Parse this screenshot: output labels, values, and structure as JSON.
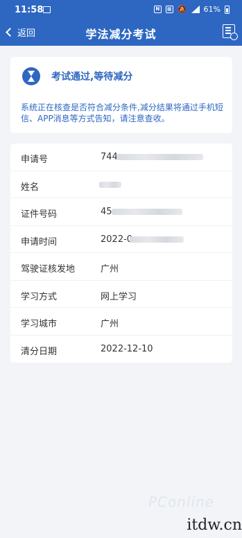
{
  "status_bar": {
    "time": "11:58",
    "battery": "61%"
  },
  "nav": {
    "back_label": "返回",
    "title": "学法减分考试"
  },
  "status_card": {
    "title": "考试通过,等待减分",
    "description": "系统正在核查是否符合减分条件,减分结果将通过手机短信、APP消息等方式告知，请注意查收。"
  },
  "info": {
    "rows": [
      {
        "label": "申请号",
        "value": "744"
      },
      {
        "label": "姓名",
        "value": ""
      },
      {
        "label": "证件号码",
        "value": "45"
      },
      {
        "label": "申请时间",
        "value": "2022-0"
      },
      {
        "label": "驾驶证核发地",
        "value": "广州"
      },
      {
        "label": "学习方式",
        "value": "网上学习"
      },
      {
        "label": "学习城市",
        "value": "广州"
      },
      {
        "label": "清分日期",
        "value": "2022-12-10"
      }
    ]
  },
  "watermark": {
    "text": "PConline",
    "site": "itdw.cn"
  },
  "colors": {
    "primary": "#2d67c2",
    "background": "#f2f4f7"
  }
}
